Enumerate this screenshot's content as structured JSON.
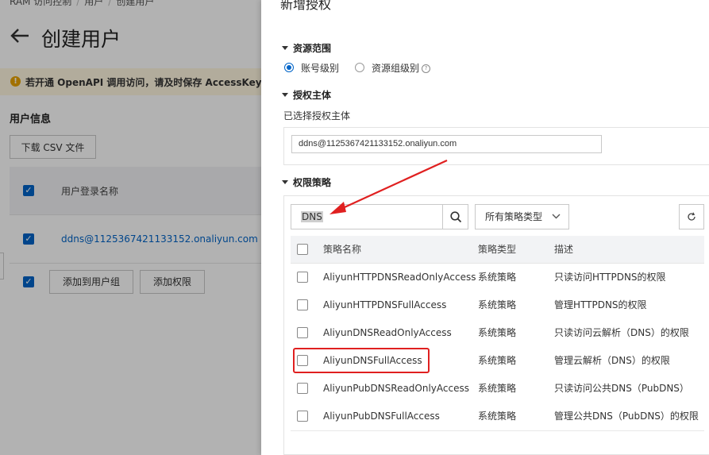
{
  "background": {
    "breadcrumb": [
      "RAM 访问控制",
      "用户",
      "创建用户"
    ],
    "page_title": "创建用户",
    "warning_text": "若开通 OpenAPI 调用访问，请及时保存 AccessKey 信",
    "section_title": "用户信息",
    "download_csv_button": "下载 CSV 文件",
    "table_header_username": "用户登录名称",
    "table_row_username": "ddns@1125367421133152.onaliyun.com",
    "add_to_group_button": "添加到用户组",
    "add_permission_button": "添加权限"
  },
  "drawer": {
    "title": "新增授权",
    "scope": {
      "heading": "资源范围",
      "option_account": "账号级别",
      "option_group": "资源组级别",
      "selected": "账号级别"
    },
    "principal": {
      "heading": "授权主体",
      "selected_label": "已选择授权主体",
      "value": "ddns@1125367421133152.onaliyun.com"
    },
    "policy": {
      "heading": "权限策略",
      "search_value": "DNS",
      "type_select": "所有策略类型",
      "columns": [
        "策略名称",
        "策略类型",
        "描述"
      ],
      "rows": [
        {
          "name": "AliyunHTTPDNSReadOnlyAccess",
          "type": "系统策略",
          "desc": "只读访问HTTPDNS的权限"
        },
        {
          "name": "AliyunHTTPDNSFullAccess",
          "type": "系统策略",
          "desc": "管理HTTPDNS的权限"
        },
        {
          "name": "AliyunDNSReadOnlyAccess",
          "type": "系统策略",
          "desc": "只读访问云解析（DNS）的权限"
        },
        {
          "name": "AliyunDNSFullAccess",
          "type": "系统策略",
          "desc": "管理云解析（DNS）的权限"
        },
        {
          "name": "AliyunPubDNSReadOnlyAccess",
          "type": "系统策略",
          "desc": "只读访问公共DNS（PubDNS）"
        },
        {
          "name": "AliyunPubDNSFullAccess",
          "type": "系统策略",
          "desc": "管理公共DNS（PubDNS）的权限"
        }
      ]
    }
  },
  "colors": {
    "primary": "#0064c8",
    "warning_bg": "#fff7e0",
    "annotation": "#e02020"
  }
}
